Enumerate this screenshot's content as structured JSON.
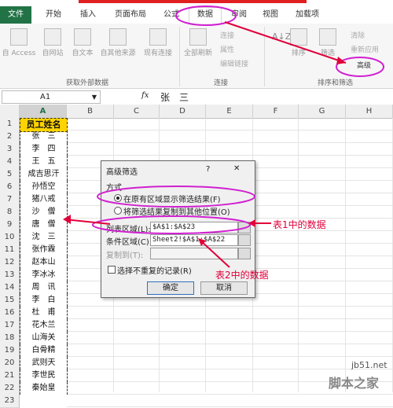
{
  "ribbon": {
    "tabs": [
      "文件",
      "开始",
      "插入",
      "页面布局",
      "公式",
      "数据",
      "审阅",
      "视图",
      "加载项"
    ],
    "ext_buttons": [
      "自 Access",
      "自网站",
      "自文本",
      "自其他来源",
      "现有连接"
    ],
    "ext_group": "获取外部数据",
    "refresh": "全部刷新",
    "conn_small": [
      "连接",
      "属性",
      "编辑链接"
    ],
    "conn_group": "连接",
    "sort_small": "排序",
    "filter": "筛选",
    "filter_small": [
      "清除",
      "重新应用",
      "高级"
    ],
    "sort_group": "排序和筛选"
  },
  "formula": {
    "cell": "A1",
    "fx": "fx",
    "value": "张　三"
  },
  "columns": [
    "A",
    "B",
    "C",
    "D",
    "E",
    "F",
    "G",
    "H"
  ],
  "rows": [
    "1",
    "2",
    "3",
    "4",
    "5",
    "6",
    "7",
    "8",
    "9",
    "10",
    "11",
    "12",
    "13",
    "14",
    "15",
    "16",
    "17",
    "18",
    "19",
    "20",
    "21",
    "22",
    "23"
  ],
  "names": [
    "员工姓名",
    "张　三",
    "李　四",
    "王　五",
    "成吉思汗",
    "孙悟空",
    "猪八戒",
    "沙　僧",
    "唐　僧",
    "沈　三",
    "张作霖",
    "赵本山",
    "李冰冰",
    "周　讯",
    "李　白",
    "杜　甫",
    "花木兰",
    "山海关",
    "白骨精",
    "武则天",
    "李世民",
    "秦始皇"
  ],
  "dialog": {
    "title": "高级筛选",
    "help": "?",
    "close": "✕",
    "method_label": "方式",
    "opt1": "在原有区域显示筛选结果(F)",
    "opt2": "将筛选结果复制到其他位置(O)",
    "list_label": "列表区域(L):",
    "list_value": "$A$1:$A$23",
    "crit_label": "条件区域(C):",
    "crit_value": "Sheet2!$A$1:$A$22",
    "copy_label": "复制到(T):",
    "unique_label": "选择不重复的记录(R)",
    "ok": "确定",
    "cancel": "取消"
  },
  "annotations": {
    "a1": "表1中的数据",
    "a2": "表2中的数据",
    "watermark1": "jb51.net",
    "watermark2": "脚本之家"
  },
  "colors": {
    "excel_green": "#217346",
    "header_yellow": "#ffd400",
    "annotation": "#e0003a"
  }
}
